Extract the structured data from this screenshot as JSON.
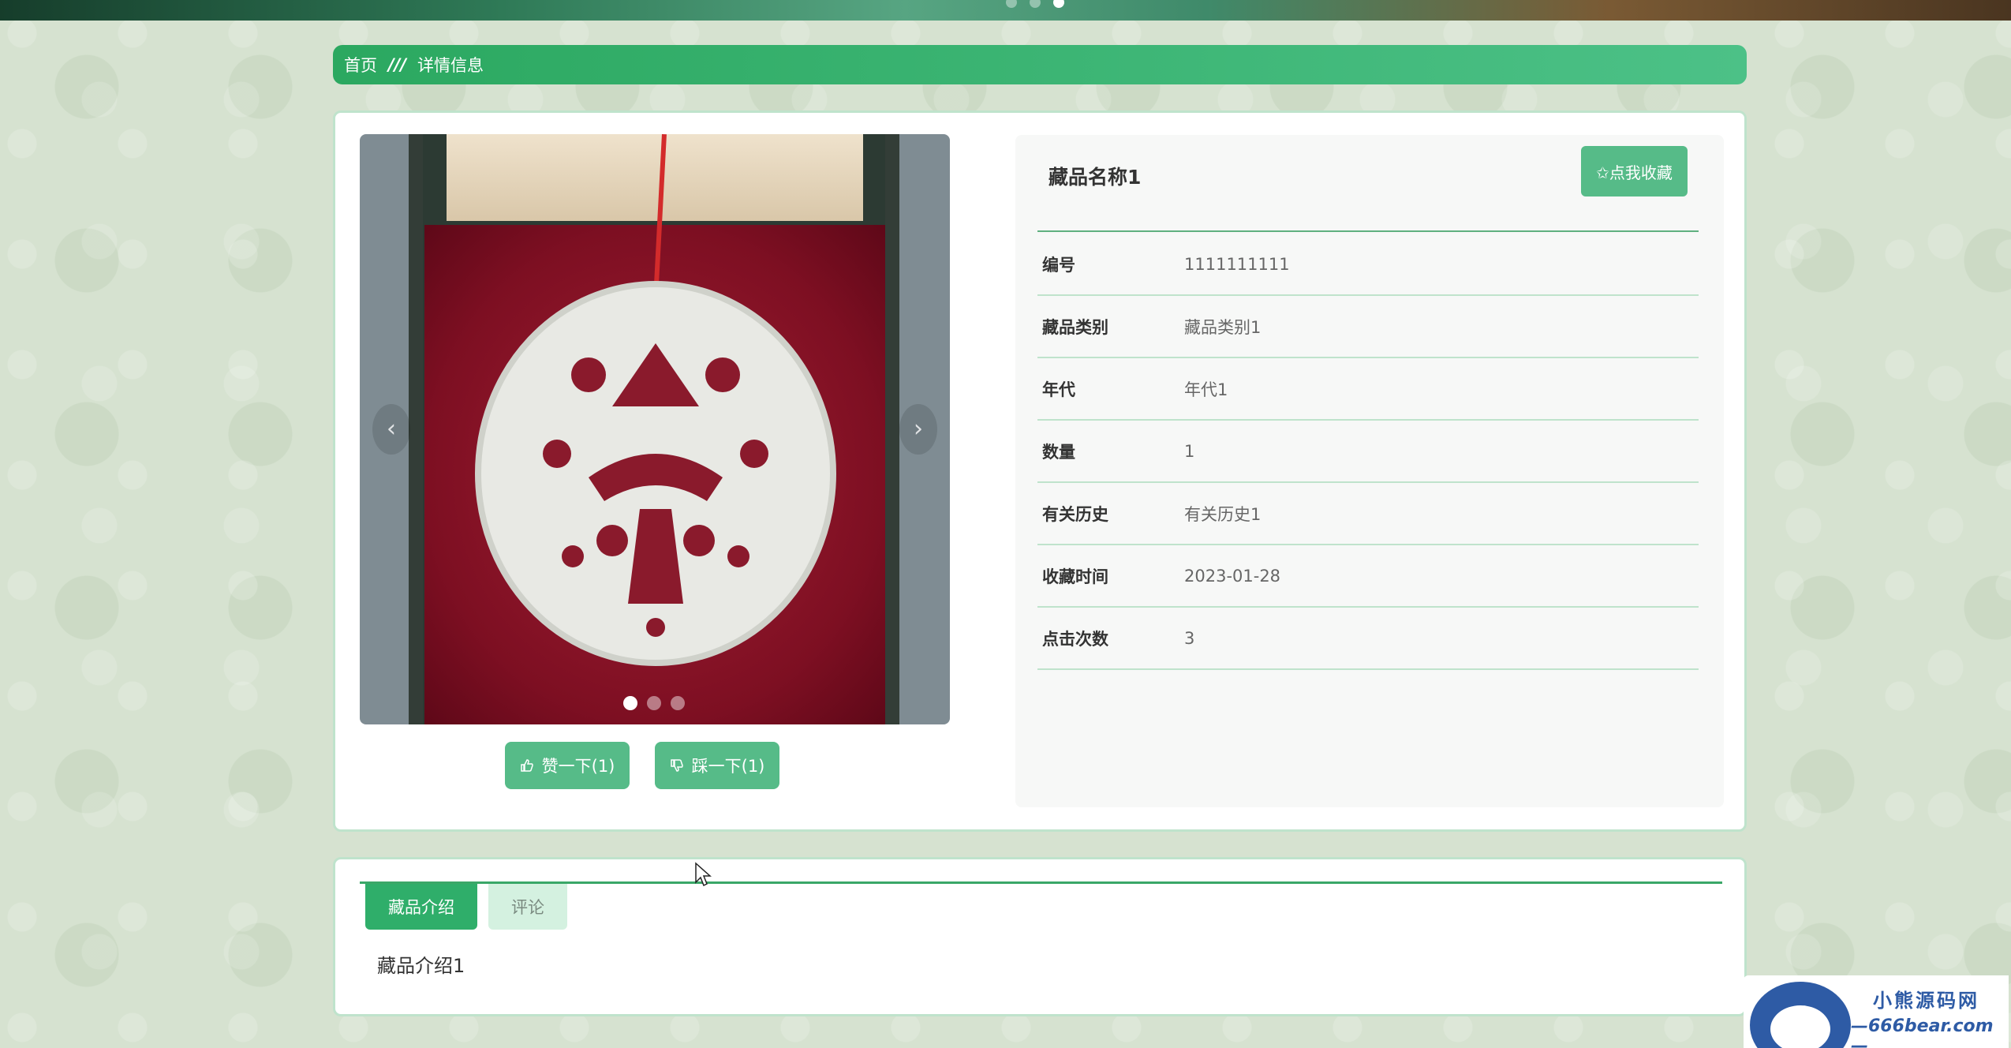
{
  "breadcrumb": {
    "home": "首页",
    "separator": "///",
    "current": "详情信息"
  },
  "item": {
    "name": "藏品名称1",
    "favorite_label": "✩点我收藏",
    "fields": [
      {
        "label": "编号",
        "value": "1111111111"
      },
      {
        "label": "藏品类别",
        "value": "藏品类别1"
      },
      {
        "label": "年代",
        "value": "年代1"
      },
      {
        "label": "数量",
        "value": "1"
      },
      {
        "label": "有关历史",
        "value": "有关历史1"
      },
      {
        "label": "收藏时间",
        "value": "2023-01-28"
      },
      {
        "label": "点击次数",
        "value": "3"
      }
    ]
  },
  "carousel": {
    "prev_icon": "chevron-left-icon",
    "next_icon": "chevron-right-icon",
    "slides": 3,
    "active_slide": 1
  },
  "actions": {
    "like_label": "赞一下(1)",
    "dislike_label": "踩一下(1)"
  },
  "tabs": [
    {
      "label": "藏品介绍",
      "active": true
    },
    {
      "label": "评论",
      "active": false
    }
  ],
  "tab_content": "藏品介绍1",
  "watermark": {
    "title": "小熊源码网",
    "url": "—666bear.com—"
  },
  "colors": {
    "accent": "#2ba860",
    "accent_light": "#56bb88",
    "border": "#bfe3cc"
  }
}
